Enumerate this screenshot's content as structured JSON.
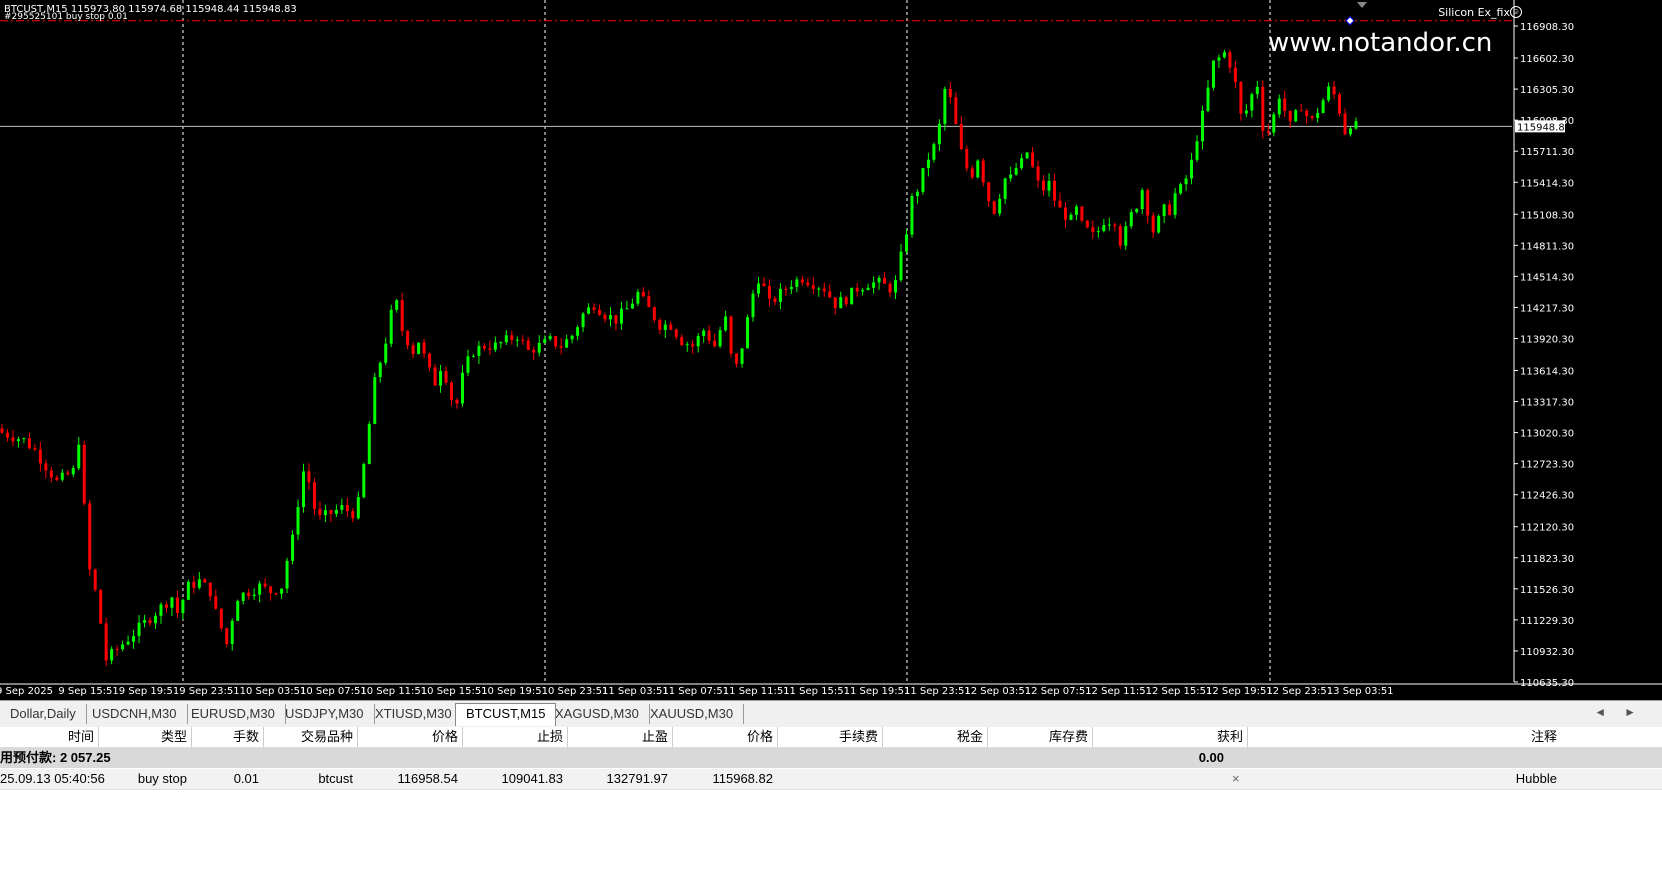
{
  "chart": {
    "header": "BTCUST,M15  115973.80 115974.68 115948.44 115948.83",
    "sub_header": "#295525101 buy stop 0.01",
    "ea_label": "Silicon Ex_fix",
    "ea_icon": "smiley-icon",
    "watermark": "www.notandor.cn",
    "current_price": "115948.83",
    "price_axis": [
      "116908.30",
      "116602.30",
      "116305.30",
      "116008.30",
      "115711.30",
      "115414.30",
      "115108.30",
      "114811.30",
      "114514.30",
      "114217.30",
      "113920.30",
      "113614.30",
      "113317.30",
      "113020.30",
      "112723.30",
      "112426.30",
      "112120.30",
      "111823.30",
      "111526.30",
      "111229.30",
      "110932.30",
      "110635.30"
    ],
    "time_axis": [
      "9 Sep 2025",
      "9 Sep 15:51",
      "9 Sep 19:51",
      "9 Sep 23:51",
      "10 Sep 03:51",
      "10 Sep 07:51",
      "10 Sep 11:51",
      "10 Sep 15:51",
      "10 Sep 19:51",
      "10 Sep 23:51",
      "11 Sep 03:51",
      "11 Sep 07:51",
      "11 Sep 11:51",
      "11 Sep 15:51",
      "11 Sep 19:51",
      "11 Sep 23:51",
      "12 Sep 03:51",
      "12 Sep 07:51",
      "12 Sep 11:51",
      "12 Sep 15:51",
      "12 Sep 19:51",
      "12 Sep 23:51",
      "13 Sep 03:51"
    ],
    "colors": {
      "bull": "#00ff00",
      "bear": "#ff0000",
      "order_line": "#ff0000",
      "bid_line": "#c0c0c0",
      "grid": "#ffffff"
    }
  },
  "chart_data": {
    "type": "candlestick",
    "symbol": "BTCUST",
    "timeframe": "M15",
    "ylim": [
      110635.3,
      117100
    ],
    "order_price": 116958.54,
    "last_price": 115948.83,
    "close_path": [
      [
        0,
        113020
      ],
      [
        4,
        112950
      ],
      [
        6,
        112850
      ],
      [
        8,
        112700
      ],
      [
        10,
        112550
      ],
      [
        13,
        112650
      ],
      [
        14,
        112950
      ],
      [
        15,
        112300
      ],
      [
        16,
        111700
      ],
      [
        17,
        111500
      ],
      [
        18,
        111200
      ],
      [
        19,
        110850
      ],
      [
        21,
        110950
      ],
      [
        23,
        111050
      ],
      [
        25,
        111150
      ],
      [
        27,
        111250
      ],
      [
        29,
        111350
      ],
      [
        31,
        111450
      ],
      [
        32,
        111300
      ],
      [
        34,
        111550
      ],
      [
        36,
        111600
      ],
      [
        38,
        111500
      ],
      [
        39,
        111300
      ],
      [
        40,
        111150
      ],
      [
        41,
        111000
      ],
      [
        42,
        111250
      ],
      [
        43,
        111450
      ],
      [
        45,
        111500
      ],
      [
        47,
        111550
      ],
      [
        49,
        111500
      ],
      [
        51,
        111550
      ],
      [
        52,
        111800
      ],
      [
        53,
        112000
      ],
      [
        54,
        112350
      ],
      [
        55,
        112650
      ],
      [
        56,
        112550
      ],
      [
        57,
        112300
      ],
      [
        58,
        112200
      ],
      [
        60,
        112250
      ],
      [
        62,
        112300
      ],
      [
        64,
        112250
      ],
      [
        65,
        112350
      ],
      [
        66,
        112700
      ],
      [
        67,
        113100
      ],
      [
        68,
        113500
      ],
      [
        69,
        113700
      ],
      [
        70,
        113900
      ],
      [
        71,
        114150
      ],
      [
        72,
        114250
      ],
      [
        73,
        114000
      ],
      [
        75,
        113800
      ],
      [
        76,
        113900
      ],
      [
        77,
        113750
      ],
      [
        78,
        113600
      ],
      [
        79,
        113500
      ],
      [
        80,
        113650
      ],
      [
        81,
        113550
      ],
      [
        82,
        113350
      ],
      [
        83,
        113300
      ],
      [
        84,
        113550
      ],
      [
        85,
        113700
      ],
      [
        86,
        113800
      ],
      [
        88,
        113850
      ],
      [
        90,
        113850
      ],
      [
        92,
        113900
      ],
      [
        94,
        113950
      ],
      [
        96,
        113800
      ],
      [
        98,
        113850
      ],
      [
        100,
        113900
      ],
      [
        102,
        113850
      ],
      [
        104,
        113950
      ],
      [
        106,
        114150
      ],
      [
        108,
        114250
      ],
      [
        110,
        114150
      ],
      [
        112,
        114100
      ],
      [
        114,
        114200
      ],
      [
        116,
        114350
      ],
      [
        118,
        114200
      ],
      [
        120,
        114050
      ],
      [
        122,
        114050
      ],
      [
        124,
        113900
      ],
      [
        126,
        113850
      ],
      [
        128,
        114000
      ],
      [
        130,
        113850
      ],
      [
        131,
        114000
      ],
      [
        132,
        114100
      ],
      [
        133,
        113750
      ],
      [
        134,
        113650
      ],
      [
        135,
        113850
      ],
      [
        136,
        114100
      ],
      [
        137,
        114350
      ],
      [
        138,
        114500
      ],
      [
        139,
        114400
      ],
      [
        140,
        114250
      ],
      [
        142,
        114350
      ],
      [
        144,
        114450
      ],
      [
        146,
        114500
      ],
      [
        148,
        114450
      ],
      [
        150,
        114400
      ],
      [
        152,
        114250
      ],
      [
        154,
        114300
      ],
      [
        156,
        114400
      ],
      [
        158,
        114450
      ],
      [
        160,
        114450
      ],
      [
        162,
        114400
      ],
      [
        163,
        114450
      ],
      [
        164,
        114700
      ],
      [
        165,
        114950
      ],
      [
        166,
        115250
      ],
      [
        167,
        115350
      ],
      [
        168,
        115500
      ],
      [
        169,
        115650
      ],
      [
        170,
        115750
      ],
      [
        171,
        115950
      ],
      [
        172,
        116300
      ],
      [
        173,
        116200
      ],
      [
        174,
        115950
      ],
      [
        175,
        115700
      ],
      [
        176,
        115550
      ],
      [
        177,
        115500
      ],
      [
        178,
        115650
      ],
      [
        179,
        115450
      ],
      [
        180,
        115250
      ],
      [
        181,
        115150
      ],
      [
        182,
        115300
      ],
      [
        183,
        115450
      ],
      [
        184,
        115450
      ],
      [
        185,
        115550
      ],
      [
        186,
        115600
      ],
      [
        187,
        115700
      ],
      [
        188,
        115550
      ],
      [
        189,
        115400
      ],
      [
        190,
        115350
      ],
      [
        191,
        115400
      ],
      [
        192,
        115250
      ],
      [
        193,
        115150
      ],
      [
        194,
        115100
      ],
      [
        195,
        115050
      ],
      [
        196,
        115150
      ],
      [
        197,
        115000
      ],
      [
        198,
        114950
      ],
      [
        199,
        114900
      ],
      [
        200,
        114950
      ],
      [
        201,
        115050
      ],
      [
        203,
        115050
      ],
      [
        204,
        114850
      ],
      [
        205,
        114950
      ],
      [
        206,
        115100
      ],
      [
        207,
        115200
      ],
      [
        208,
        115350
      ],
      [
        209,
        115150
      ],
      [
        210,
        114950
      ],
      [
        211,
        115050
      ],
      [
        212,
        115150
      ],
      [
        213,
        115150
      ],
      [
        214,
        115300
      ],
      [
        215,
        115350
      ],
      [
        216,
        115450
      ],
      [
        217,
        115600
      ],
      [
        218,
        115850
      ],
      [
        219,
        116050
      ],
      [
        220,
        116300
      ],
      [
        221,
        116550
      ],
      [
        222,
        116600
      ],
      [
        223,
        116650
      ],
      [
        224,
        116550
      ],
      [
        225,
        116350
      ],
      [
        226,
        116050
      ],
      [
        227,
        116100
      ],
      [
        228,
        116250
      ],
      [
        229,
        116350
      ],
      [
        230,
        115950
      ],
      [
        231,
        115900
      ],
      [
        232,
        116050
      ],
      [
        233,
        116250
      ],
      [
        234,
        116100
      ],
      [
        235,
        115950
      ],
      [
        236,
        116050
      ],
      [
        237,
        116150
      ],
      [
        238,
        116050
      ],
      [
        239,
        116000
      ],
      [
        240,
        116100
      ],
      [
        241,
        116200
      ],
      [
        242,
        116300
      ],
      [
        243,
        116250
      ],
      [
        244,
        116100
      ],
      [
        245,
        115900
      ],
      [
        246,
        115980
      ],
      [
        247,
        115948
      ]
    ]
  },
  "tabs": {
    "items": [
      "Dollar,Daily",
      "USDCNH,M30",
      "EURUSD,M30",
      "USDJPY,M30",
      "XTIUSD,M30",
      "BTCUST,M15",
      "XAGUSD,M30",
      "XAUUSD,M30"
    ],
    "active": "BTCUST,M15",
    "scroll_left": "◄",
    "scroll_right": "►"
  },
  "table": {
    "headers": [
      "时间",
      "类型",
      "手数",
      "交易品种",
      "价格",
      "止损",
      "止盈",
      "价格",
      "手续费",
      "税金",
      "库存费",
      "获利",
      "注释"
    ],
    "balance_label": "用预付款: 2 057.25",
    "balance_profit": "0.00",
    "order": {
      "time": "25.09.13 05:40:56",
      "type": "buy stop",
      "lots": "0.01",
      "symbol": "btcust",
      "price": "116958.54",
      "sl": "109041.83",
      "tp": "132791.97",
      "current_price": "115968.82",
      "close": "×",
      "comment": "Hubble"
    }
  }
}
